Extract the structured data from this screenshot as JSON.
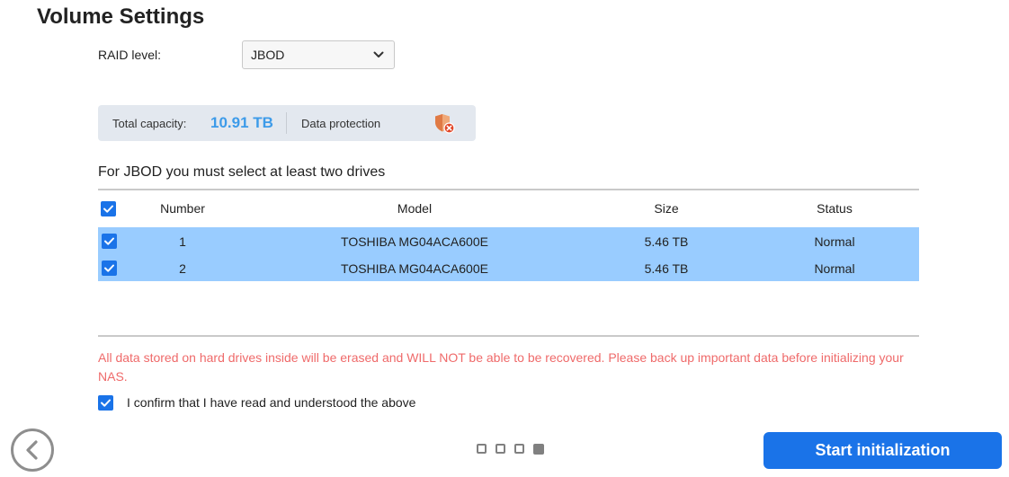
{
  "page": {
    "title": "Volume Settings"
  },
  "raid": {
    "label": "RAID level:",
    "selected": "JBOD"
  },
  "capacity": {
    "label": "Total capacity:",
    "value": "10.91 TB",
    "protection_label": "Data protection",
    "protection_icon": "shield-x-icon",
    "value_color": "#3d9be9"
  },
  "hint": "For JBOD you must select at least two drives",
  "table": {
    "headers": {
      "number": "Number",
      "model": "Model",
      "size": "Size",
      "status": "Status"
    },
    "select_all_checked": true,
    "rows": [
      {
        "checked": true,
        "number": "1",
        "model": "TOSHIBA MG04ACA600E",
        "size": "5.46 TB",
        "status": "Normal"
      },
      {
        "checked": true,
        "number": "2",
        "model": "TOSHIBA MG04ACA600E",
        "size": "5.46 TB",
        "status": "Normal"
      }
    ],
    "selected_row_color": "#99ccff"
  },
  "warning": "All data stored on hard drives inside will be erased and WILL NOT be able to be recovered. Please back up important data before initializing your NAS.",
  "confirm": {
    "checked": true,
    "label": "I confirm that I have read and understood the above"
  },
  "footer": {
    "back_icon": "chevron-left-icon",
    "steps_total": 4,
    "current_step": 4,
    "start_label": "Start initialization",
    "accent_color": "#1a73e8"
  }
}
